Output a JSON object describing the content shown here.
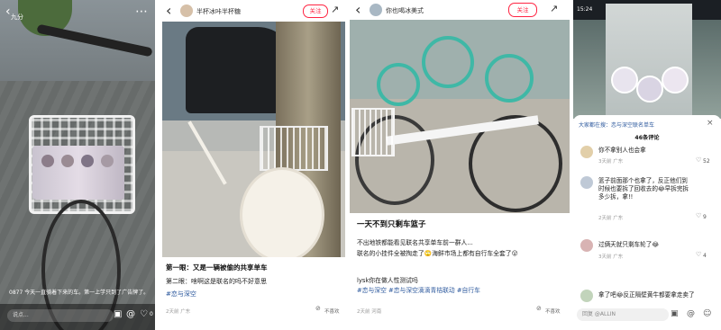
{
  "panel1": {
    "top_text": "九分",
    "caption": "0877 今天一直骑着下来的车。第一上学只到了广告牌了。",
    "reply_placeholder": "说点...",
    "like_count": "0"
  },
  "panel2": {
    "username": "半杯冰咔半杯糖",
    "follow_label": "关注",
    "post_text_line1": "第一眼：又是一辆被偷的共享单车",
    "post_text_line2": "第二眼：啥啊这是联名的吗不好意思",
    "hashtag": "#恋与深空",
    "meta_time": "2天前 广东",
    "dislike_label": "不喜欢"
  },
  "panel3": {
    "username": "你也喝冰美式",
    "follow_label": "关注",
    "title": "一天不到只剩车篮子",
    "body_line1": "不出地铁都能看见联名共享单车前一群人...",
    "body_line2": "联名的小挂件全被掏走了🙄海鲜市场上都有自行车全套了😮",
    "body_line3": "lysk你在做人性测试吗",
    "hashtags": "#恋与深空 #恋与深空滴滴青桔联动 #自行车",
    "meta_time": "2天前 河南",
    "dislike_label": "不喜欢"
  },
  "panel4": {
    "status_time": "15:24",
    "header": "大家都在搜：恋与深空联名单车",
    "comment_count": "46条评论",
    "comments": [
      {
        "text": "你不拿别人也会拿",
        "meta": "3天前 广东",
        "likes": "52"
      },
      {
        "text": "篮子前面那个也拿了，反正他们到时候也要拆了回收去的😂早拆完拆多少拆，拿!!",
        "meta": "2天前 广东",
        "likes": "9"
      },
      {
        "text": "过俩天就只剩车轮了😂",
        "meta": "3天前 广东",
        "likes": "4"
      },
      {
        "text": "拿了吧😂反正隔壁黄牛都要拿走卖了",
        "meta": "",
        "likes": ""
      }
    ],
    "input_placeholder": "回复 @ALLIN"
  }
}
